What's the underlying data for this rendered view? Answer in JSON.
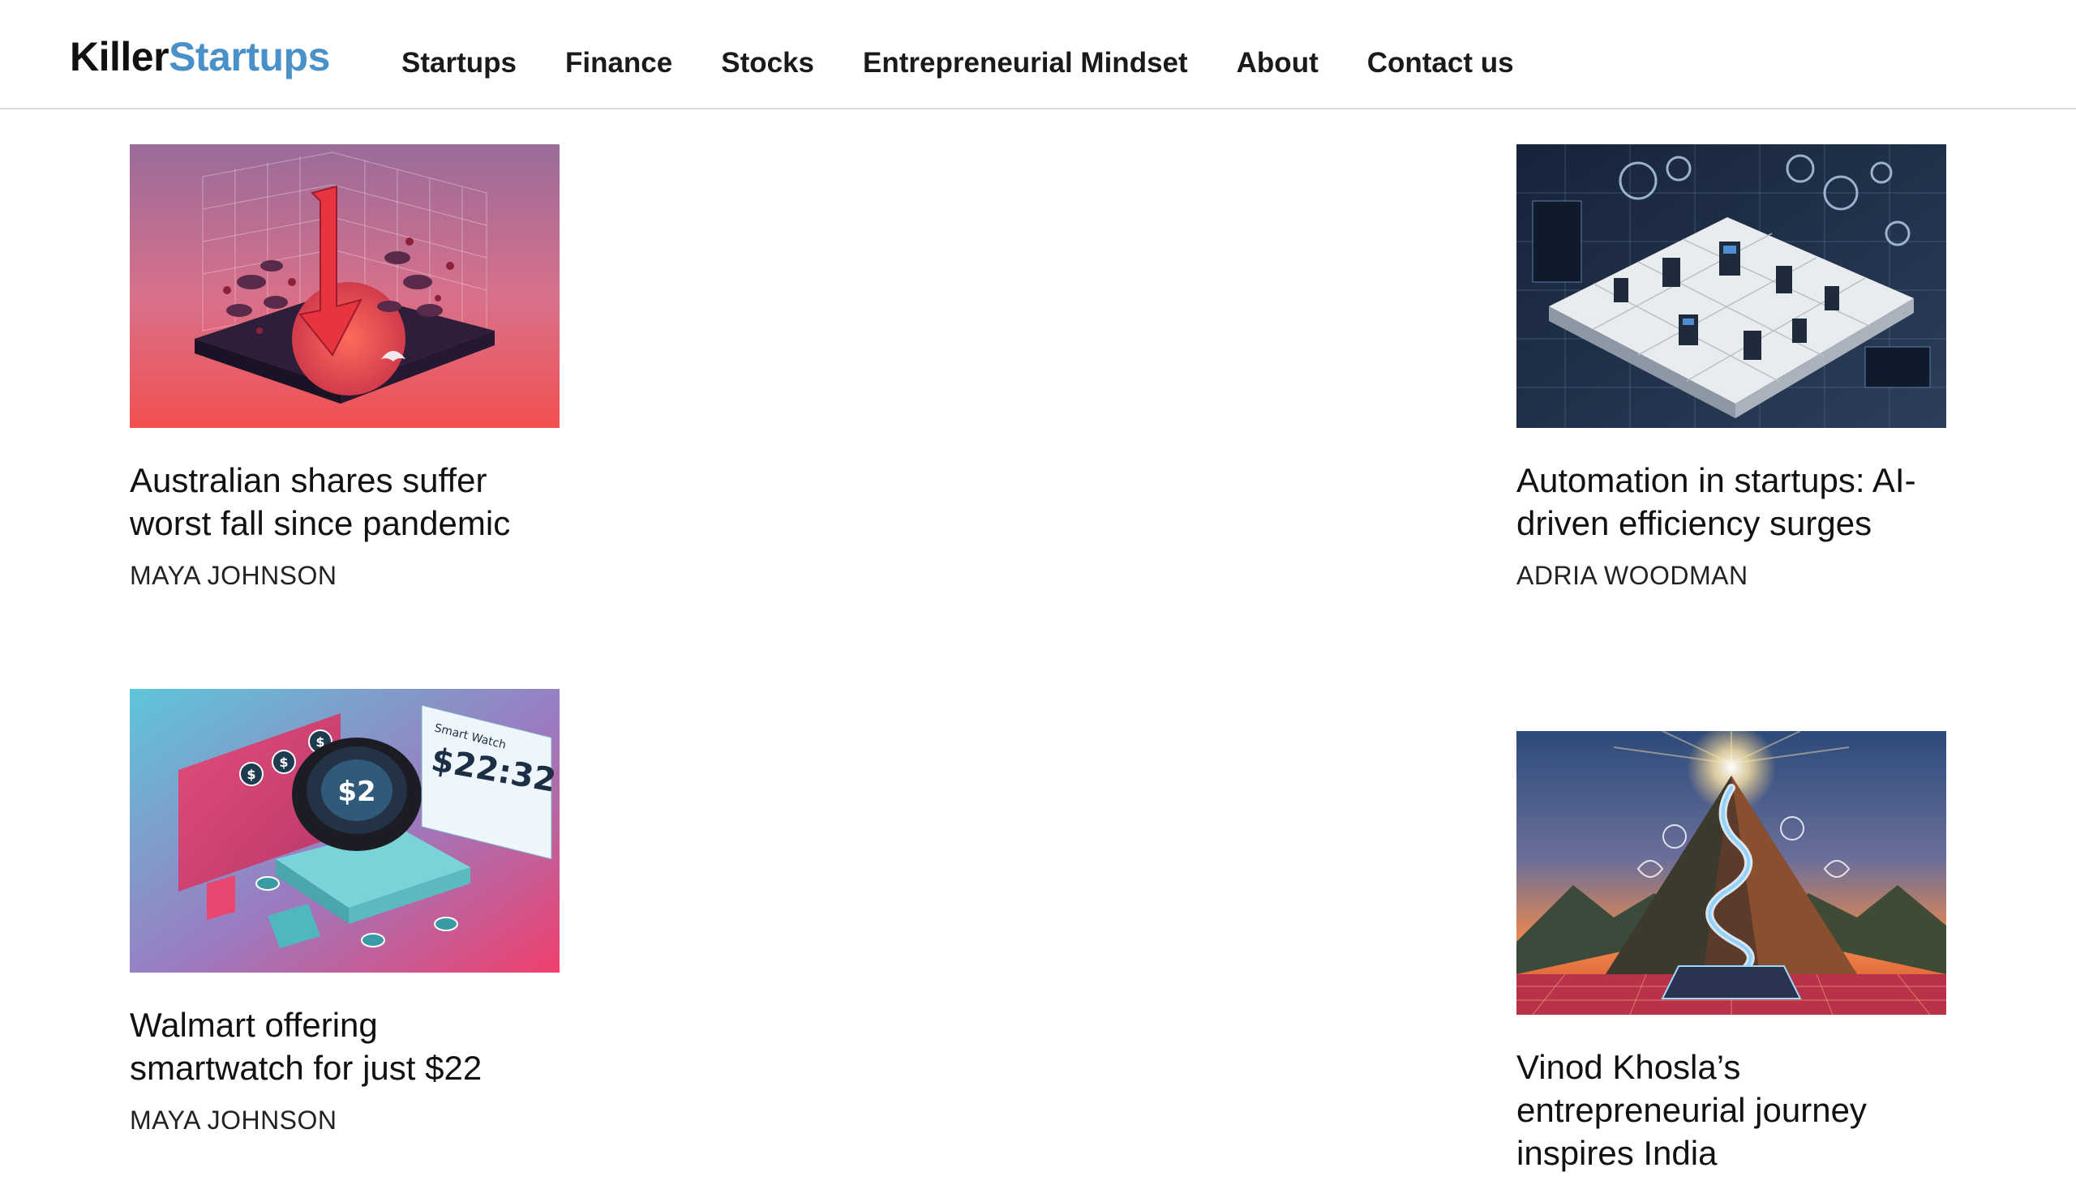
{
  "header": {
    "logo_part1": "Killer",
    "logo_part2": "Startups",
    "nav": [
      "Startups",
      "Finance",
      "Stocks",
      "Entrepreneurial Mindset",
      "About",
      "Contact us"
    ]
  },
  "articles": [
    {
      "title": "Australian shares suffer worst fall since pandemic",
      "author": "MAYA JOHNSON",
      "image": "down-arrow-market-illustration"
    },
    {
      "title": "Automation in startups: AI-driven efficiency surges",
      "author": "ADRIA WOODMAN",
      "image": "automation-factory-illustration"
    },
    {
      "title": "Walmart offering smartwatch for just $22",
      "author": "MAYA JOHNSON",
      "image": "smartwatch-shopping-illustration",
      "image_text": {
        "watch_face": "$2",
        "panel_label": "Smart Watch",
        "panel_price": "$22:32"
      }
    },
    {
      "title": "Vinod Khosla’s entrepreneurial journey inspires India",
      "author": "",
      "image": "mountain-path-illustration"
    }
  ],
  "colors": {
    "brand_dark": "#111111",
    "brand_blue": "#4a90c9",
    "divider": "#dcdcdc"
  }
}
